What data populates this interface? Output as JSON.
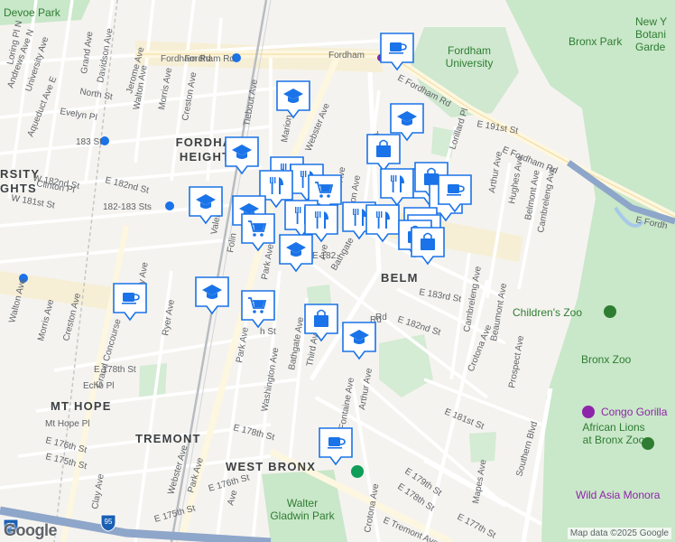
{
  "colors": {
    "pin": "#1a73e8",
    "park": "#c9e7c9",
    "highway": "#8ea6c9",
    "road": "#ffffff",
    "zoo_label": "#2e7d32",
    "transit": "#8e24aa"
  },
  "neighborhoods": [
    {
      "id": "fordham-heights",
      "lines": [
        "FORDHAM",
        "HEIGHTS"
      ]
    },
    {
      "id": "mt-hope",
      "lines": [
        "MT HOPE"
      ]
    },
    {
      "id": "tremont",
      "lines": [
        "TREMONT"
      ]
    },
    {
      "id": "west-bronx",
      "lines": [
        "WEST BRONX"
      ]
    },
    {
      "id": "belmont",
      "lines": [
        "BELM"
      ]
    },
    {
      "id": "university-heights",
      "lines": [
        "RSITY",
        "GHTS"
      ]
    }
  ],
  "pois": [
    {
      "id": "devoe-park",
      "label": "Devoe Park"
    },
    {
      "id": "fordham-university",
      "label": "Fordham University"
    },
    {
      "id": "bronx-park",
      "label": "Bronx Park"
    },
    {
      "id": "ny-botanical",
      "label": "New Y Botani Garde"
    },
    {
      "id": "childrens-zoo",
      "label": "Children's Zoo"
    },
    {
      "id": "bronx-zoo",
      "label": "Bronx Zoo"
    },
    {
      "id": "congo-gorilla",
      "label": "Congo Gorilla"
    },
    {
      "id": "african-lions",
      "label": "African Lions at Bronx Zoo"
    },
    {
      "id": "wild-asia",
      "label": "Wild Asia Monora"
    },
    {
      "id": "walter-gladwin-park",
      "label": "Walter Gladwin Park"
    }
  ],
  "streets": [
    {
      "id": "s1",
      "label": "Fordham Rd"
    },
    {
      "id": "s2",
      "label": "Fordham Rd"
    },
    {
      "id": "s3",
      "label": "Fordham"
    },
    {
      "id": "s4",
      "label": "E Fordham Rd"
    },
    {
      "id": "s5",
      "label": "E 191st St"
    },
    {
      "id": "s6",
      "label": "E Fordham Rd"
    },
    {
      "id": "s7",
      "label": "E Fordh"
    },
    {
      "id": "s8",
      "label": "Loring Pl N"
    },
    {
      "id": "s9",
      "label": "Andrews Ave N"
    },
    {
      "id": "s10",
      "label": "University Ave"
    },
    {
      "id": "s11",
      "label": "Grand Ave"
    },
    {
      "id": "s12",
      "label": "Davidson Ave"
    },
    {
      "id": "s13",
      "label": "Jerome Ave"
    },
    {
      "id": "s14",
      "label": "Aqueduct Ave E"
    },
    {
      "id": "s15",
      "label": "North St"
    },
    {
      "id": "s16",
      "label": "Walton Ave"
    },
    {
      "id": "s17",
      "label": "Morris Ave"
    },
    {
      "id": "s18",
      "label": "Creston Ave"
    },
    {
      "id": "s19",
      "label": "Evelyn Pl"
    },
    {
      "id": "s20",
      "label": "183 St"
    },
    {
      "id": "s21",
      "label": "W 182nd St"
    },
    {
      "id": "s22",
      "label": "Clinton Pl"
    },
    {
      "id": "s23",
      "label": "W 181st St"
    },
    {
      "id": "s24",
      "label": "E 182nd St"
    },
    {
      "id": "s25",
      "label": "182-183 Sts"
    },
    {
      "id": "s26",
      "label": "Tiebout Ave"
    },
    {
      "id": "s27",
      "label": "Marion"
    },
    {
      "id": "s28",
      "label": "Webster Ave"
    },
    {
      "id": "s29",
      "label": "Third"
    },
    {
      "id": "s30",
      "label": "Lorillard Pl"
    },
    {
      "id": "s31",
      "label": "Arthur Ave"
    },
    {
      "id": "s32",
      "label": "Hughes Ave"
    },
    {
      "id": "s33",
      "label": "Belmont Ave"
    },
    {
      "id": "s34",
      "label": "Cambreleng Ave"
    },
    {
      "id": "s35",
      "label": "Valentine"
    },
    {
      "id": "s36",
      "label": "Folin"
    },
    {
      "id": "s37",
      "label": "Park Ave"
    },
    {
      "id": "s38",
      "label": "Washington Ave"
    },
    {
      "id": "s39",
      "label": "Bathgate"
    },
    {
      "id": "s40",
      "label": "E 183rd St"
    },
    {
      "id": "s41",
      "label": "Cambreleng Ave"
    },
    {
      "id": "s42",
      "label": "Beaumont Ave"
    },
    {
      "id": "s43",
      "label": "E 182nd St"
    },
    {
      "id": "s44",
      "label": "Crotona Ave"
    },
    {
      "id": "s45",
      "label": "Prospect Ave"
    },
    {
      "id": "s46",
      "label": "Third Ave"
    },
    {
      "id": "s47",
      "label": "Rd"
    },
    {
      "id": "s48",
      "label": "Anthony Ave"
    },
    {
      "id": "s49",
      "label": "Ryer Ave"
    },
    {
      "id": "s50",
      "label": "Grand Concourse"
    },
    {
      "id": "s51",
      "label": "Morris Ave"
    },
    {
      "id": "s52",
      "label": "Walton Ave"
    },
    {
      "id": "s53",
      "label": "Creston Ave"
    },
    {
      "id": "s54",
      "label": "E 178th St"
    },
    {
      "id": "s55",
      "label": "Echo Pl"
    },
    {
      "id": "s56",
      "label": "Mt Hope Pl"
    },
    {
      "id": "s57",
      "label": "E 176th St"
    },
    {
      "id": "s58",
      "label": "E 175th St"
    },
    {
      "id": "s59",
      "label": "Clay Ave"
    },
    {
      "id": "s60",
      "label": "Webster Ave"
    },
    {
      "id": "s61",
      "label": "Park Ave"
    },
    {
      "id": "s62",
      "label": "E 176th St"
    },
    {
      "id": "s63",
      "label": "E 175th St"
    },
    {
      "id": "s64",
      "label": "Park Ave"
    },
    {
      "id": "s65",
      "label": "Washington Ave"
    },
    {
      "id": "s66",
      "label": "Bathgate Ave"
    },
    {
      "id": "s67",
      "label": "E 178th St"
    },
    {
      "id": "s68",
      "label": "Fontaine Ave"
    },
    {
      "id": "s69",
      "label": "Arthur Ave"
    },
    {
      "id": "s70",
      "label": "E 181st St"
    },
    {
      "id": "s71",
      "label": "E 179th St"
    },
    {
      "id": "s72",
      "label": "E 178th St"
    },
    {
      "id": "s73",
      "label": "Mapes Ave"
    },
    {
      "id": "s74",
      "label": "Southern Blvd"
    },
    {
      "id": "s75",
      "label": "Crotona Ave"
    },
    {
      "id": "s76",
      "label": "E Tremont Ave"
    },
    {
      "id": "s77",
      "label": "E 177th St"
    },
    {
      "id": "s78",
      "label": "Ave"
    },
    {
      "id": "s79",
      "label": "h St"
    },
    {
      "id": "s80",
      "label": "E 182"
    },
    {
      "id": "s81",
      "label": "Rd"
    },
    {
      "id": "s82",
      "label": "hington Ave"
    },
    {
      "id": "s83",
      "label": "Ave"
    }
  ],
  "shields": [
    {
      "id": "i95-a",
      "label": "95"
    },
    {
      "id": "i95-b",
      "label": "95"
    }
  ],
  "pins": [
    {
      "id": "p1",
      "type": "coffee"
    },
    {
      "id": "p2",
      "type": "school"
    },
    {
      "id": "p3",
      "type": "school"
    },
    {
      "id": "p4",
      "type": "shopping"
    },
    {
      "id": "p5",
      "type": "school"
    },
    {
      "id": "p6",
      "type": "restaurant"
    },
    {
      "id": "p7",
      "type": "restaurant"
    },
    {
      "id": "p8",
      "type": "restaurant"
    },
    {
      "id": "p9",
      "type": "grocery"
    },
    {
      "id": "p10",
      "type": "school"
    },
    {
      "id": "p11",
      "type": "school"
    },
    {
      "id": "p12",
      "type": "grocery"
    },
    {
      "id": "p13",
      "type": "restaurant"
    },
    {
      "id": "p14",
      "type": "restaurant"
    },
    {
      "id": "p15",
      "type": "restaurant"
    },
    {
      "id": "p16",
      "type": "restaurant"
    },
    {
      "id": "p17",
      "type": "restaurant"
    },
    {
      "id": "p18",
      "type": "restaurant"
    },
    {
      "id": "p19",
      "type": "shopping"
    },
    {
      "id": "p20",
      "type": "coffee"
    },
    {
      "id": "p21",
      "type": "coffee"
    },
    {
      "id": "p22",
      "type": "school"
    },
    {
      "id": "p23",
      "type": "school"
    },
    {
      "id": "p24",
      "type": "shopping"
    },
    {
      "id": "p25",
      "type": "shopping"
    },
    {
      "id": "p26",
      "type": "school"
    },
    {
      "id": "p27",
      "type": "coffee"
    },
    {
      "id": "p28",
      "type": "school"
    },
    {
      "id": "p29",
      "type": "grocery"
    },
    {
      "id": "p30",
      "type": "shopping"
    },
    {
      "id": "p31",
      "type": "school"
    },
    {
      "id": "p32",
      "type": "coffee"
    }
  ],
  "attribution": "Map data ©2025 Google",
  "logo": "Google"
}
